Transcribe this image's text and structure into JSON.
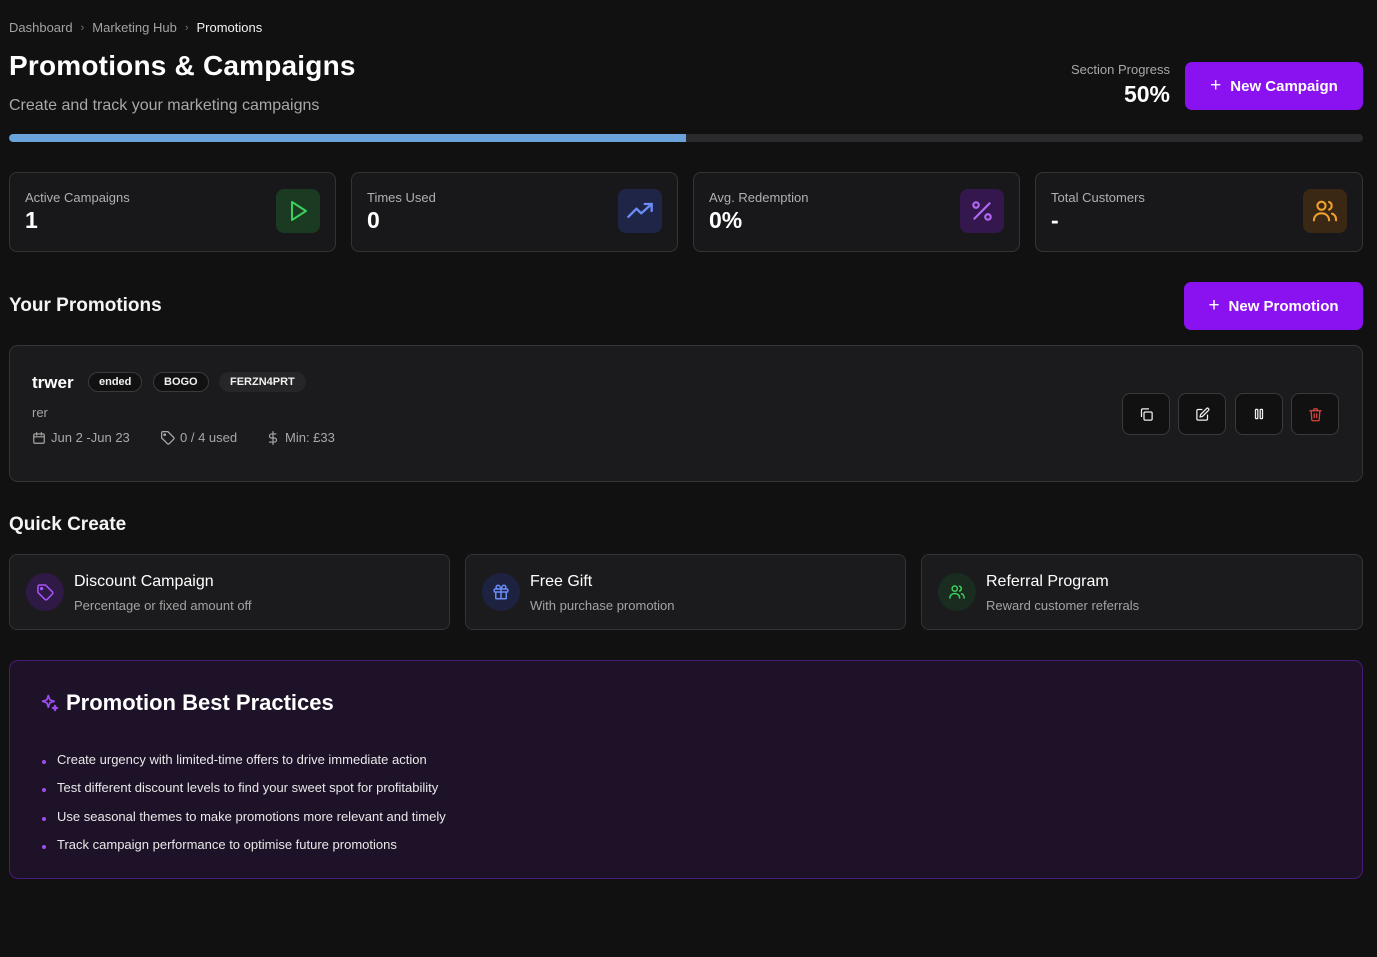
{
  "breadcrumb": [
    "Dashboard",
    "Marketing Hub",
    "Promotions"
  ],
  "header": {
    "title": "Promotions & Campaigns",
    "subtitle": "Create and track your marketing campaigns",
    "progress_label": "Section Progress",
    "progress_value": "50%",
    "progress_fraction": 0.5,
    "new_campaign_label": "New Campaign"
  },
  "stats": [
    {
      "label": "Active Campaigns",
      "value": "1",
      "icon": "play-icon",
      "color": "#3ccf5c"
    },
    {
      "label": "Times Used",
      "value": "0",
      "icon": "trending-up-icon",
      "color": "#6b8cf7"
    },
    {
      "label": "Avg. Redemption",
      "value": "0%",
      "icon": "percent-icon",
      "color": "#a855f7"
    },
    {
      "label": "Total Customers",
      "value": "-",
      "icon": "users-icon",
      "color": "#f0a02c"
    }
  ],
  "promotions": {
    "section_title": "Your Promotions",
    "new_label": "New Promotion",
    "items": [
      {
        "name": "trwer",
        "status": "ended",
        "type": "BOGO",
        "code": "FERZN4PRT",
        "description": "rer",
        "dates": "Jun 2 -Jun 23",
        "usage": "0 / 4 used",
        "min": "Min: £33"
      }
    ]
  },
  "quick_create": {
    "section_title": "Quick Create",
    "items": [
      {
        "title": "Discount Campaign",
        "subtitle": "Percentage or fixed amount off",
        "icon": "tag-icon",
        "color": "#a855f7"
      },
      {
        "title": "Free Gift",
        "subtitle": "With purchase promotion",
        "icon": "gift-icon",
        "color": "#6b8cf7"
      },
      {
        "title": "Referral Program",
        "subtitle": "Reward customer referrals",
        "icon": "users-icon",
        "color": "#3ccf5c"
      }
    ]
  },
  "best_practices": {
    "title": "Promotion Best Practices",
    "tips": [
      "Create urgency with limited-time offers to drive immediate action",
      "Test different discount levels to find your sweet spot for profitability",
      "Use seasonal themes to make promotions more relevant and timely",
      "Track campaign performance to optimise future promotions"
    ]
  },
  "colors": {
    "accent": "#8b12f0",
    "background": "#111112",
    "progress": "#6aa3dc",
    "danger": "#e0443e"
  }
}
